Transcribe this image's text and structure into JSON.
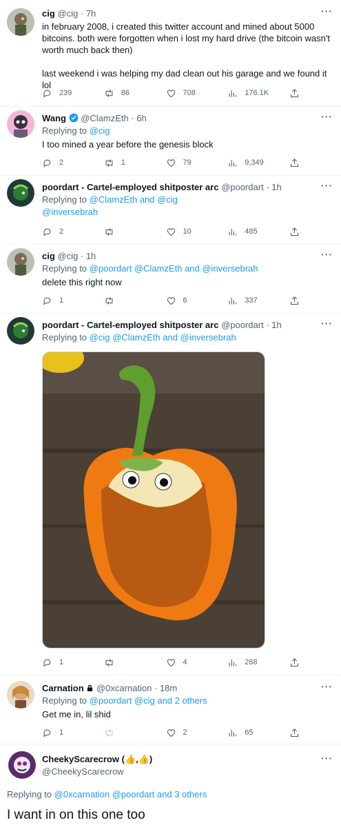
{
  "tweets": [
    {
      "name": "cig",
      "handle": "@cig",
      "time": "· 7h",
      "text": "in february 2008, i created this twitter account and mined about 5000 bitcoins. both were forgotten when i lost my hard drive (the bitcoin wasn't worth much back then)",
      "text2": "last weekend i was helping my dad clean out his garage and we found it lol",
      "replies": "239",
      "retweets": "86",
      "likes": "708",
      "views": "176.1K"
    },
    {
      "name": "Wang",
      "handle": "@ClamzEth",
      "time": "· 6h",
      "reply_label": "Replying to",
      "reply_to": "@cig",
      "text": "I too mined a year before the genesis block",
      "replies": "2",
      "retweets": "1",
      "likes": "79",
      "views": "9,349"
    },
    {
      "name": "poordart - Cartel-employed shitposter arc",
      "handle": "@poordart",
      "time": "· 1h",
      "reply_label": "Replying to",
      "reply_to_1": "@ClamzEth",
      "reply_and": "and",
      "reply_to_2": "@cig",
      "line2": "@inversebrah",
      "replies": "2",
      "retweets": "",
      "likes": "10",
      "views": "485"
    },
    {
      "name": "cig",
      "handle": "@cig",
      "time": "· 1h",
      "reply_label": "Replying to",
      "reply_to": "@poordart @ClamzEth and @inversebrah",
      "text": "delete this right now",
      "replies": "1",
      "retweets": "",
      "likes": "6",
      "views": "337"
    },
    {
      "name": "poordart - Cartel-employed shitposter arc",
      "handle": "@poordart",
      "time": "· 1h",
      "reply_label": "Replying to",
      "reply_to": "@cig @ClamzEth and @inversebrah",
      "image_desc": "orange-bell-pepper-with-googly-eyes",
      "replies": "1",
      "retweets": "",
      "likes": "4",
      "views": "268"
    },
    {
      "name": "Carnation",
      "handle": "@0xcarnation",
      "time": "· 18m",
      "reply_label": "Replying to",
      "reply_to": "@poordart @cig and 2 others",
      "text": "Get me in, lil shid",
      "replies": "1",
      "retweets": "",
      "likes": "2",
      "views": "65"
    }
  ],
  "main": {
    "name": "CheekyScarecrow (👍,👍)",
    "handle": "@CheekyScarecrow",
    "reply_label": "Replying to",
    "reply_to": "@0xcarnation @poordart and 3 others",
    "text": "I want in on this one too"
  },
  "colors": {
    "accent": "#1d9bf0",
    "muted": "#536471",
    "text": "#0f1419"
  },
  "icons": [
    "reply-icon",
    "retweet-icon",
    "like-icon",
    "views-icon",
    "share-icon",
    "more-icon",
    "verified-icon",
    "lock-icon"
  ]
}
